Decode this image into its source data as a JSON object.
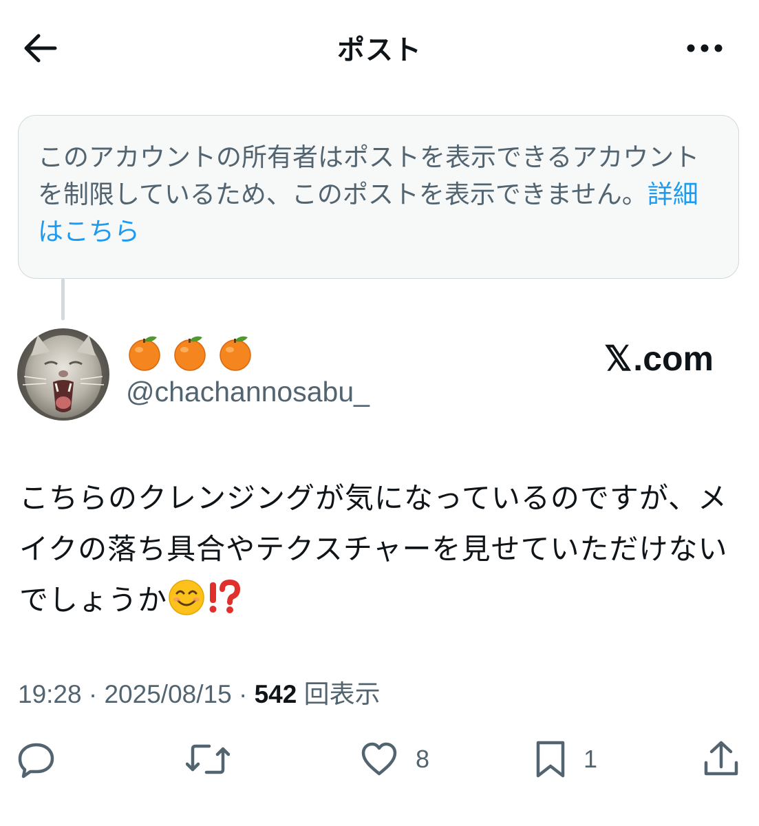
{
  "header": {
    "title": "ポスト",
    "back_icon": "arrow-left-icon",
    "more_icon": "more-horizontal-icon"
  },
  "notice": {
    "text": "このアカウントの所有者はポストを表示できるアカウントを制限しているため、このポストを表示できません。",
    "link_label": "詳細はこちら"
  },
  "author": {
    "display_name_icons": [
      "tangerine-emoji",
      "tangerine-emoji",
      "tangerine-emoji"
    ],
    "handle": "@chachannosabu_",
    "avatar": "cat-avatar"
  },
  "brand": {
    "x_glyph": "𝕏",
    "suffix": ".com"
  },
  "post": {
    "text": "こちらのクレンジングが気になっているのですが、メイクの落ち具合やテクスチャーを見せていただけないでしょうか",
    "trailing_emojis": [
      "smiling-face-emoji",
      "exclamation-question-emoji"
    ]
  },
  "meta": {
    "time": "19:28",
    "separator": "·",
    "date": "2025/08/15",
    "views_count": "542",
    "views_label": "回表示"
  },
  "actions": {
    "reply_icon": "reply-icon",
    "repost_icon": "repost-icon",
    "like_icon": "heart-icon",
    "like_count": "8",
    "bookmark_icon": "bookmark-icon",
    "bookmark_count": "1",
    "share_icon": "share-icon"
  },
  "colors": {
    "text": "#0f1419",
    "secondary": "#536471",
    "link": "#1d9bf0",
    "notice_bg": "#f7f9f9",
    "border": "#cfd9de"
  }
}
